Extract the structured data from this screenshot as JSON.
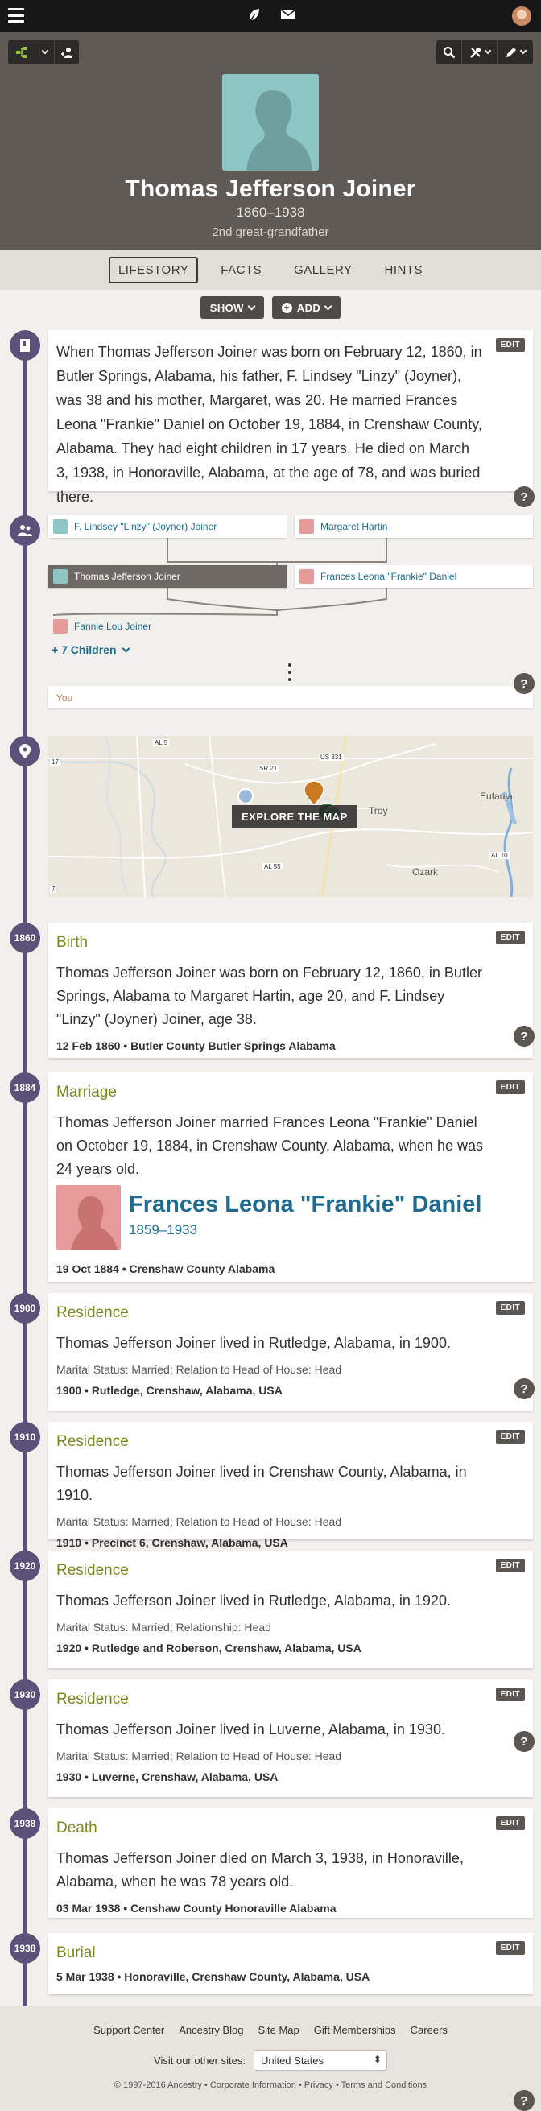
{
  "header": {
    "menu_icon": "hamburger-icon",
    "leaf_icon": "leaf-icon",
    "mail_icon": "mail-icon",
    "avatar_icon": "user-avatar"
  },
  "toolbar": {
    "tree_icon": "tree-icon",
    "dropdown_icon": "chevron-down-icon",
    "profile_icon": "person-switch-icon",
    "search_icon": "search-icon",
    "tools_icon": "tools-icon",
    "edit_icon": "pencil-icon"
  },
  "person": {
    "name": "Thomas Jefferson Joiner",
    "years": "1860–1938",
    "relation": "2nd great-grandfather"
  },
  "tabs": [
    {
      "label": "LIFESTORY",
      "active": true
    },
    {
      "label": "FACTS"
    },
    {
      "label": "GALLERY"
    },
    {
      "label": "HINTS"
    }
  ],
  "actions": {
    "show": "SHOW",
    "add": "ADD"
  },
  "story": {
    "text": "When Thomas Jefferson Joiner was born on February 12, 1860, in Butler Springs, Alabama, his father, F. Lindsey \"Linzy\" (Joyner), was 38 and his mother, Margaret, was 20. He married Frances Leona \"Frankie\" Daniel on October 19, 1884, in Crenshaw County, Alabama. They had eight children in 17 years. He died on March 3, 1938, in Honoraville, Alabama, at the age of 78, and was buried there.",
    "edit": "EDIT"
  },
  "family": {
    "father": "F. Lindsey \"Linzy\" (Joyner) Joiner",
    "mother": "Margaret Hartin",
    "self": "Thomas Jefferson Joiner",
    "spouse": "Frances Leona \"Frankie\" Daniel",
    "child": "Fannie Lou Joiner",
    "more_children": "+ 7 Children",
    "you": "You"
  },
  "map": {
    "button": "EXPLORE THE MAP",
    "labels": [
      "AL 5",
      "SR 21",
      "US 331",
      "Troy",
      "Eufaula",
      "AL 10",
      "AL 55",
      "Ozark",
      "17",
      "7"
    ]
  },
  "events": [
    {
      "year": "1860",
      "title": "Birth",
      "body": "Thomas Jefferson Joiner was born on February 12, 1860, in Butler Springs, Alabama to Margaret Hartin, age 20, and F. Lindsey \"Linzy\" (Joyner) Joiner, age 38.",
      "foot": "12 Feb 1860 • Butler County Butler Springs Alabama"
    },
    {
      "year": "1884",
      "title": "Marriage",
      "body": "Thomas Jefferson Joiner married Frances Leona \"Frankie\" Daniel on October 19, 1884, in Crenshaw County, Alabama, when he was 24 years old.",
      "spouse_name": "Frances Leona \"Frankie\" Daniel",
      "spouse_years": "1859–1933",
      "foot": "19 Oct 1884 • Crenshaw County Alabama"
    },
    {
      "year": "1900",
      "title": "Residence",
      "body": "Thomas Jefferson Joiner lived in Rutledge, Alabama, in 1900.",
      "sub": "Marital Status: Married; Relation to Head of House: Head",
      "foot": "1900 • Rutledge, Crenshaw, Alabama, USA"
    },
    {
      "year": "1910",
      "title": "Residence",
      "body": "Thomas Jefferson Joiner lived in Crenshaw County, Alabama, in 1910.",
      "sub": "Marital Status: Married; Relation to Head of House: Head",
      "foot": "1910 • Precinct 6, Crenshaw, Alabama, USA"
    },
    {
      "year": "1920",
      "title": "Residence",
      "body": "Thomas Jefferson Joiner lived in Rutledge, Alabama, in 1920.",
      "sub": "Marital Status: Married; Relationship: Head",
      "foot": "1920 • Rutledge and Roberson, Crenshaw, Alabama, USA"
    },
    {
      "year": "1930",
      "title": "Residence",
      "body": "Thomas Jefferson Joiner lived in Luverne, Alabama, in 1930.",
      "sub": "Marital Status: Married; Relation to Head of House: Head",
      "foot": "1930 • Luverne, Crenshaw, Alabama, USA"
    },
    {
      "year": "1938",
      "title": "Death",
      "body": "Thomas Jefferson Joiner died on March 3, 1938, in Honoraville, Alabama, when he was 78 years old.",
      "foot": "03 Mar 1938 • Censhaw County Honoraville Alabama"
    },
    {
      "year": "1938",
      "title": "Burial",
      "foot": "5 Mar 1938 • Honoraville, Crenshaw County, Alabama, USA"
    }
  ],
  "edit_label": "EDIT",
  "help_label": "?",
  "footer": {
    "links": [
      "Support Center",
      "Ancestry Blog",
      "Site Map",
      "Gift Memberships",
      "Careers"
    ],
    "sites_label": "Visit our other sites:",
    "site_value": "United States",
    "copyright": "© 1997-2016 Ancestry • Corporate Information • Privacy • Terms and Conditions"
  },
  "colors": {
    "timeline": "#5b5279",
    "event_title": "#758b1d",
    "link": "#1f6b8f",
    "hero_bg": "#5f5a56"
  }
}
